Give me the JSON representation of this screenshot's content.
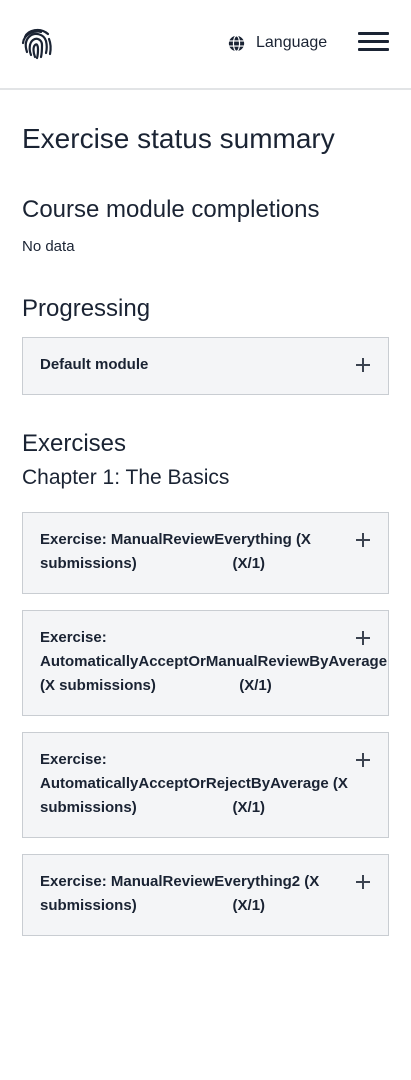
{
  "header": {
    "logo_icon": "fingerprint-icon",
    "language_icon": "globe-icon",
    "language_label": "Language",
    "menu_icon": "hamburger-menu-icon"
  },
  "main": {
    "page_title": "Exercise status summary",
    "completions": {
      "title": "Course module completions",
      "empty_text": "No data"
    },
    "progressing": {
      "title": "Progressing",
      "modules": [
        {
          "label": "Default module"
        }
      ]
    },
    "exercises": {
      "title": "Exercises",
      "chapter_title": "Chapter 1: The Basics",
      "items": [
        {
          "line1": "Exercise: ManualReviewEverything (X",
          "line2": "submissions)                       (X/1)"
        },
        {
          "line1": "Exercise:",
          "line2": "AutomaticallyAcceptOrManualReviewByAverage",
          "line3": "(X submissions)                    (X/1)"
        },
        {
          "line1": "Exercise:",
          "line2": "AutomaticallyAcceptOrRejectByAverage (X",
          "line3": "submissions)                       (X/1)"
        },
        {
          "line1": "Exercise: ManualReviewEverything2 (X",
          "line2": "submissions)                       (X/1)"
        }
      ]
    }
  }
}
